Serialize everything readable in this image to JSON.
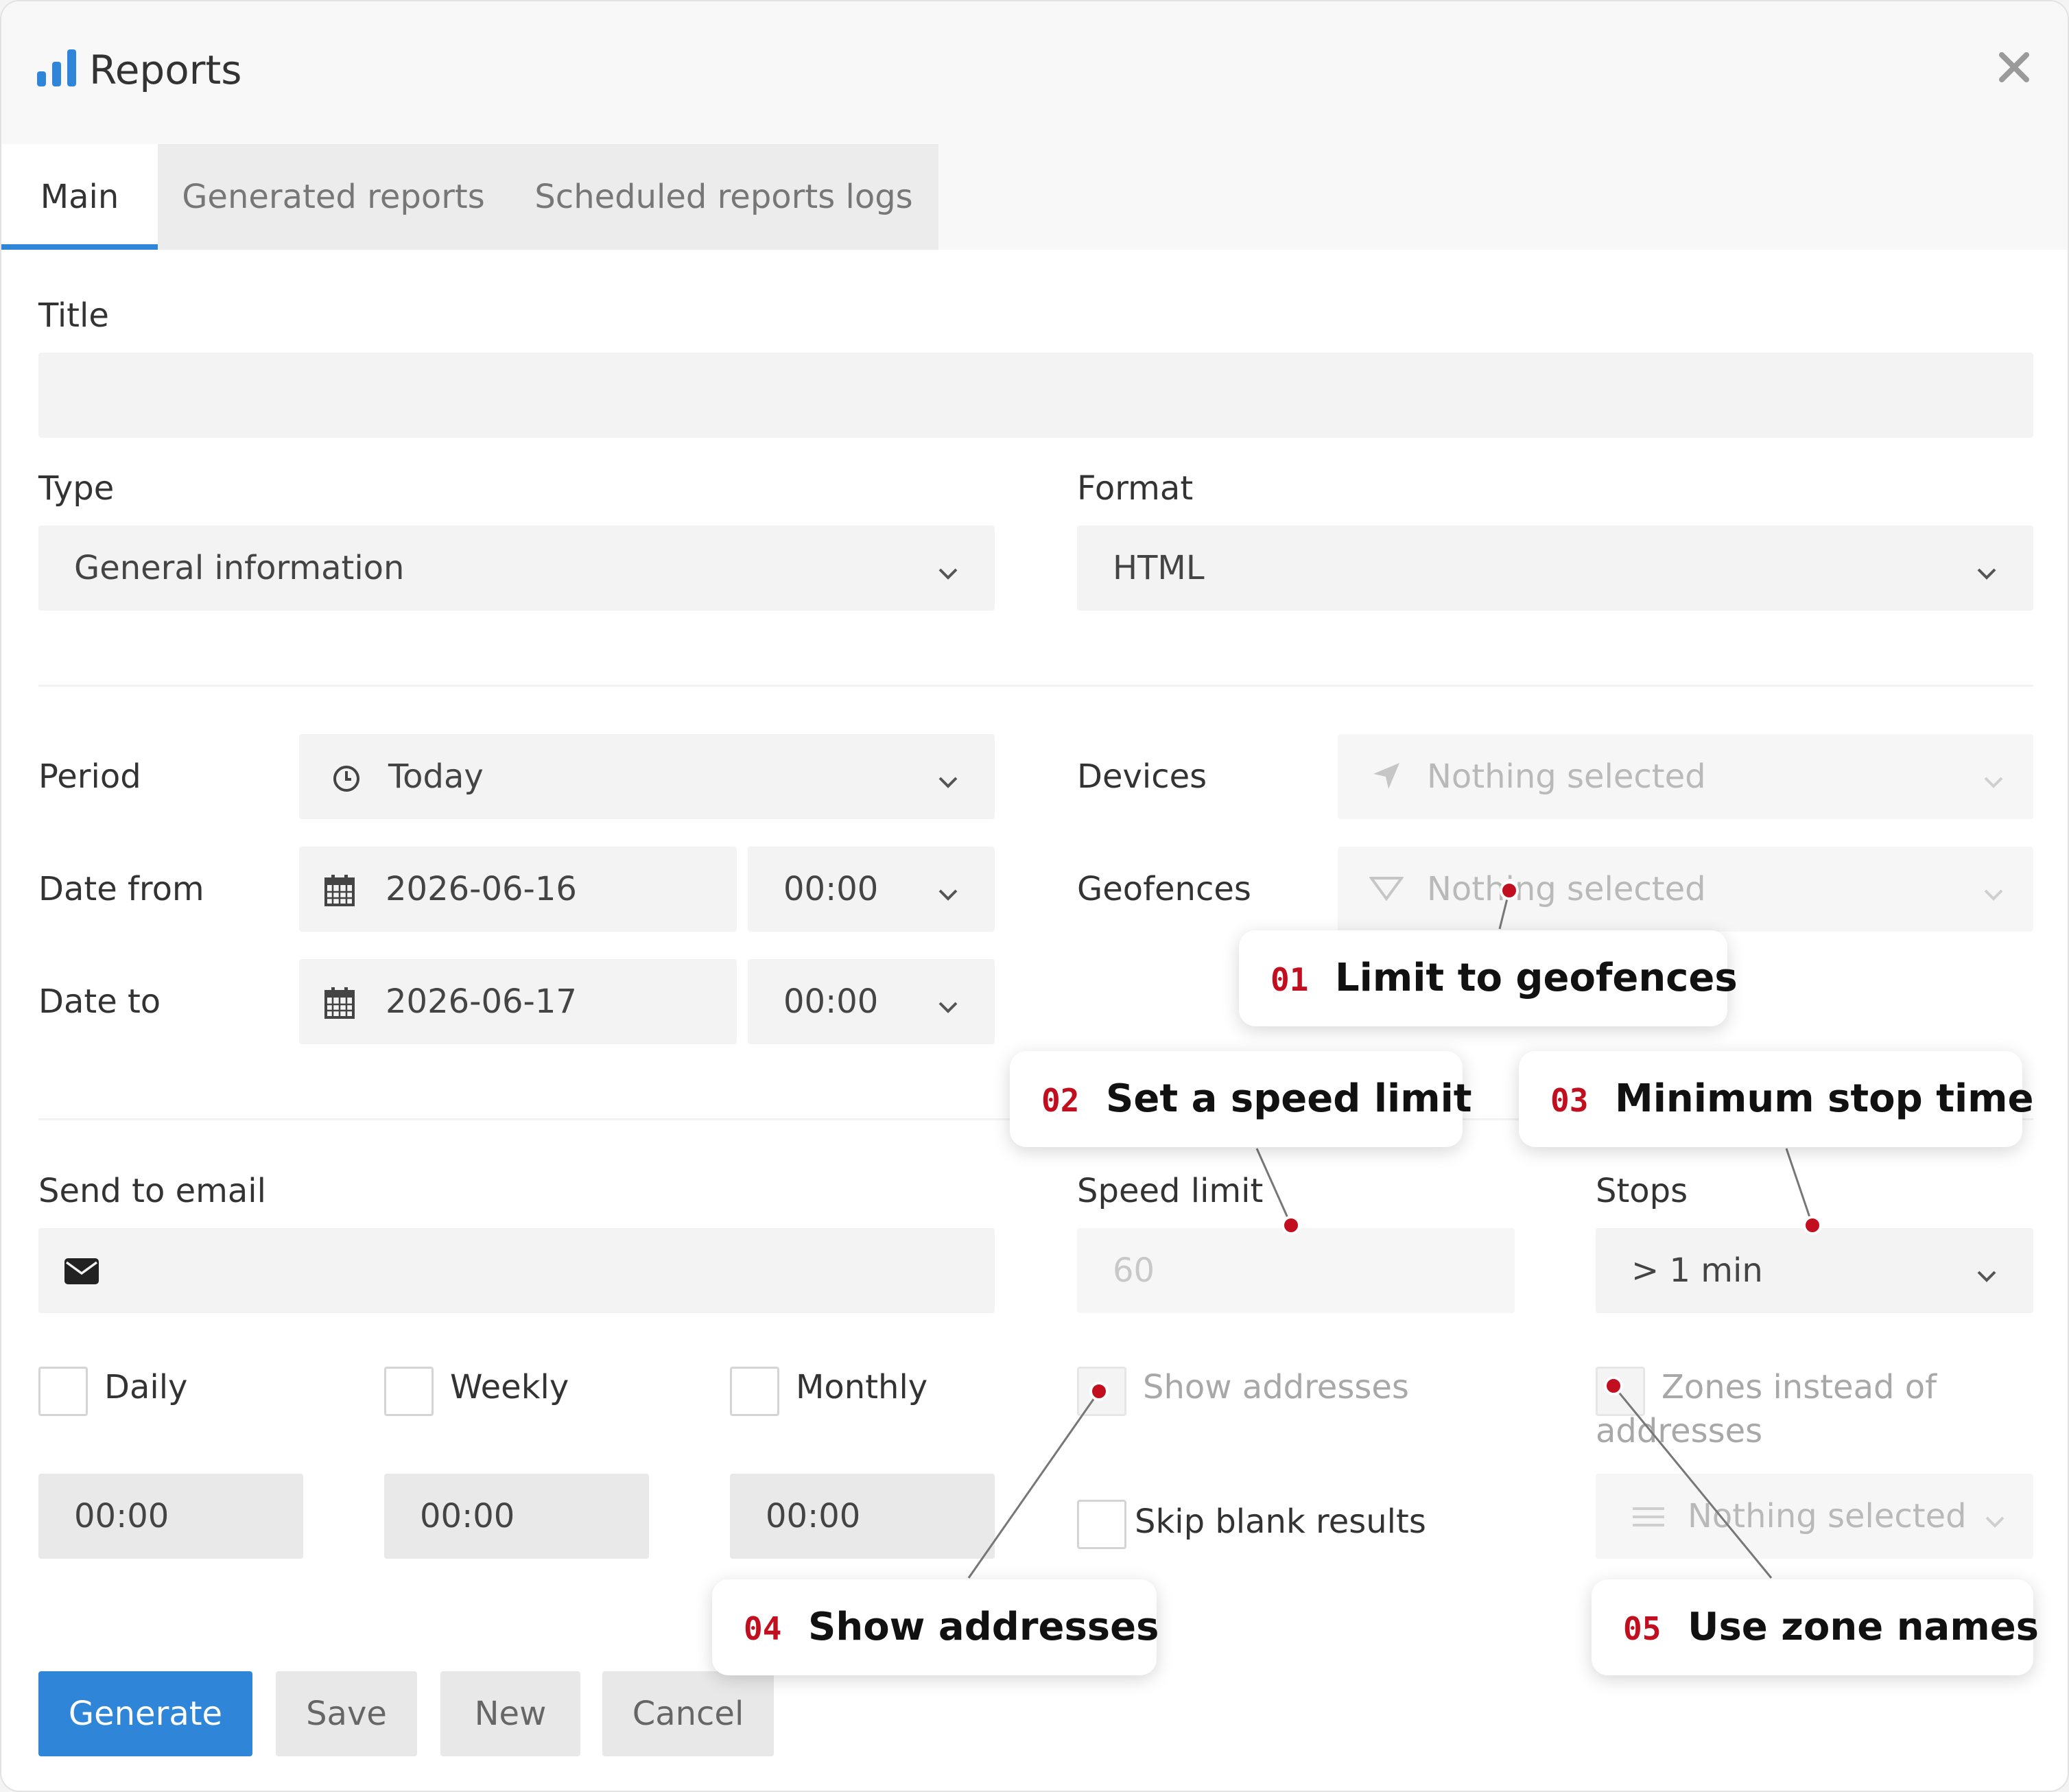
{
  "window": {
    "title": "Reports",
    "app_icon": "bar-chart-icon",
    "close_icon": "close-icon"
  },
  "tabs": [
    {
      "label": "Main",
      "active": true
    },
    {
      "label": "Generated reports",
      "active": false
    },
    {
      "label": "Scheduled reports logs",
      "active": false
    }
  ],
  "form": {
    "title": {
      "label": "Title",
      "value": ""
    },
    "type": {
      "label": "Type",
      "value": "General information"
    },
    "format": {
      "label": "Format",
      "value": "HTML"
    },
    "period": {
      "label": "Period",
      "value": "Today",
      "icon": "clock-icon"
    },
    "date_from": {
      "label": "Date from",
      "date": "2026-06-16",
      "time": "00:00",
      "icon": "calendar-icon"
    },
    "date_to": {
      "label": "Date to",
      "date": "2026-06-17",
      "time": "00:00",
      "icon": "calendar-icon"
    },
    "devices": {
      "label": "Devices",
      "placeholder": "Nothing selected",
      "icon": "location-arrow-icon"
    },
    "geofences": {
      "label": "Geofences",
      "placeholder": "Nothing selected",
      "icon": "geofence-icon"
    },
    "send_to_email": {
      "label": "Send to email",
      "value": "",
      "icon": "envelope-icon"
    },
    "speed_limit": {
      "label": "Speed limit",
      "placeholder": "60"
    },
    "stops": {
      "label": "Stops",
      "value": "> 1 min"
    },
    "schedule": [
      {
        "label": "Daily",
        "checked": false,
        "time": "00:00"
      },
      {
        "label": "Weekly",
        "checked": false,
        "time": "00:00"
      },
      {
        "label": "Monthly",
        "checked": false,
        "time": "00:00"
      }
    ],
    "show_addresses": {
      "label": "Show addresses",
      "checked": false,
      "disabled": true
    },
    "zones_instead": {
      "label_line1": "Zones instead of",
      "label_line2": "addresses",
      "checked": false,
      "disabled": true
    },
    "skip_blank": {
      "label": "Skip blank results",
      "checked": false
    },
    "zones_select": {
      "placeholder": "Nothing selected",
      "icon": "list-icon"
    }
  },
  "buttons": {
    "generate": "Generate",
    "save": "Save",
    "new": "New",
    "cancel": "Cancel"
  },
  "callouts": [
    {
      "num": "01",
      "text": "Limit to geofences"
    },
    {
      "num": "02",
      "text": "Set a speed limit"
    },
    {
      "num": "03",
      "text": "Minimum stop time"
    },
    {
      "num": "04",
      "text": "Show addresses"
    },
    {
      "num": "05",
      "text": "Use zone names"
    }
  ],
  "colors": {
    "accent": "#2f86d9",
    "callout_number": "#c10f1f",
    "marker": "#c10f1f"
  }
}
